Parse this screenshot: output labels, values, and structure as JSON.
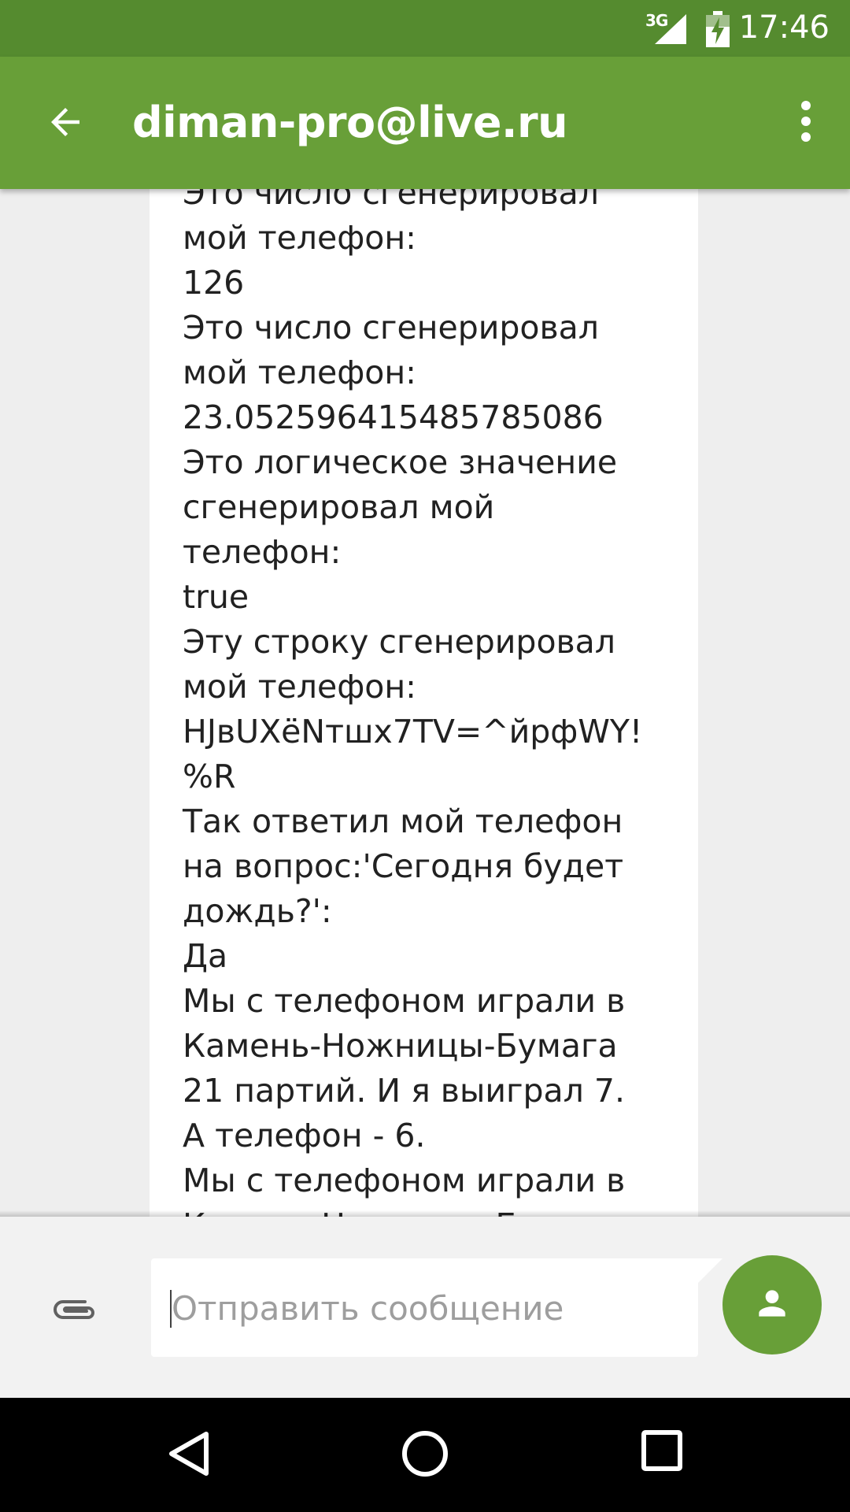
{
  "status_bar": {
    "network": "3G",
    "time": "17:46"
  },
  "app_bar": {
    "title": "diman-pro@live.ru",
    "back_icon": "arrow-back-icon",
    "menu_icon": "more-vert-icon"
  },
  "message": {
    "text": "Это число сгенерировал\nмой телефон:\n126\nЭто число сгенерировал\nмой телефон:\n23.052596415485785086\nЭто логическое значение\nсгенерировал мой\nтелефон:\ntrue\nЭту строку сгенерировал\nмой телефон:\nHJвUXёNтшx7TV=^йрфWY!\n%R\nТак ответил мой телефон\nна вопрос:'Сегодня будет\nдождь?':\nДа\nМы с телефоном играли в\nКамень-Ножницы-Бумага\n21 партий. И я выиграл 7.\nА телефон - 6.\nМы с телефоном играли в\nКамень-Ножницы-Бумага"
  },
  "compose": {
    "placeholder": "Отправить сообщение",
    "value": "",
    "attach_icon": "paperclip-icon",
    "contact_icon": "person-icon"
  },
  "nav_bar": {
    "back_icon": "nav-back-icon",
    "home_icon": "nav-home-icon",
    "recents_icon": "nav-recents-icon"
  },
  "colors": {
    "status_bar": "#558b2f",
    "app_bar": "#689f38",
    "accent": "#689f38",
    "background": "#eeeeee"
  }
}
